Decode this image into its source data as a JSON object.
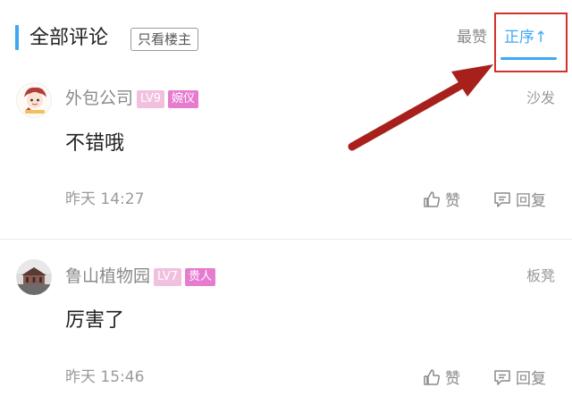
{
  "header": {
    "title": "全部评论",
    "only_host": "只看楼主",
    "sort_hot": "最赞",
    "sort_asc": "正序↑"
  },
  "comments": [
    {
      "username": "外包公司",
      "level": "LV9",
      "title_badge": "婉仪",
      "floor": "沙发",
      "content": "不错哦",
      "time": "昨天 14:27",
      "like_label": "赞",
      "reply_label": "回复"
    },
    {
      "username": "鲁山植物园",
      "level": "LV7",
      "title_badge": "贵人",
      "floor": "板凳",
      "content": "厉害了",
      "time": "昨天 15:46",
      "like_label": "赞",
      "reply_label": "回复"
    }
  ],
  "colors": {
    "accent": "#3ea8f5",
    "annotation_red": "#d0312d",
    "level_badge": "#f2c0df",
    "title_badge": "#e67bd0"
  }
}
